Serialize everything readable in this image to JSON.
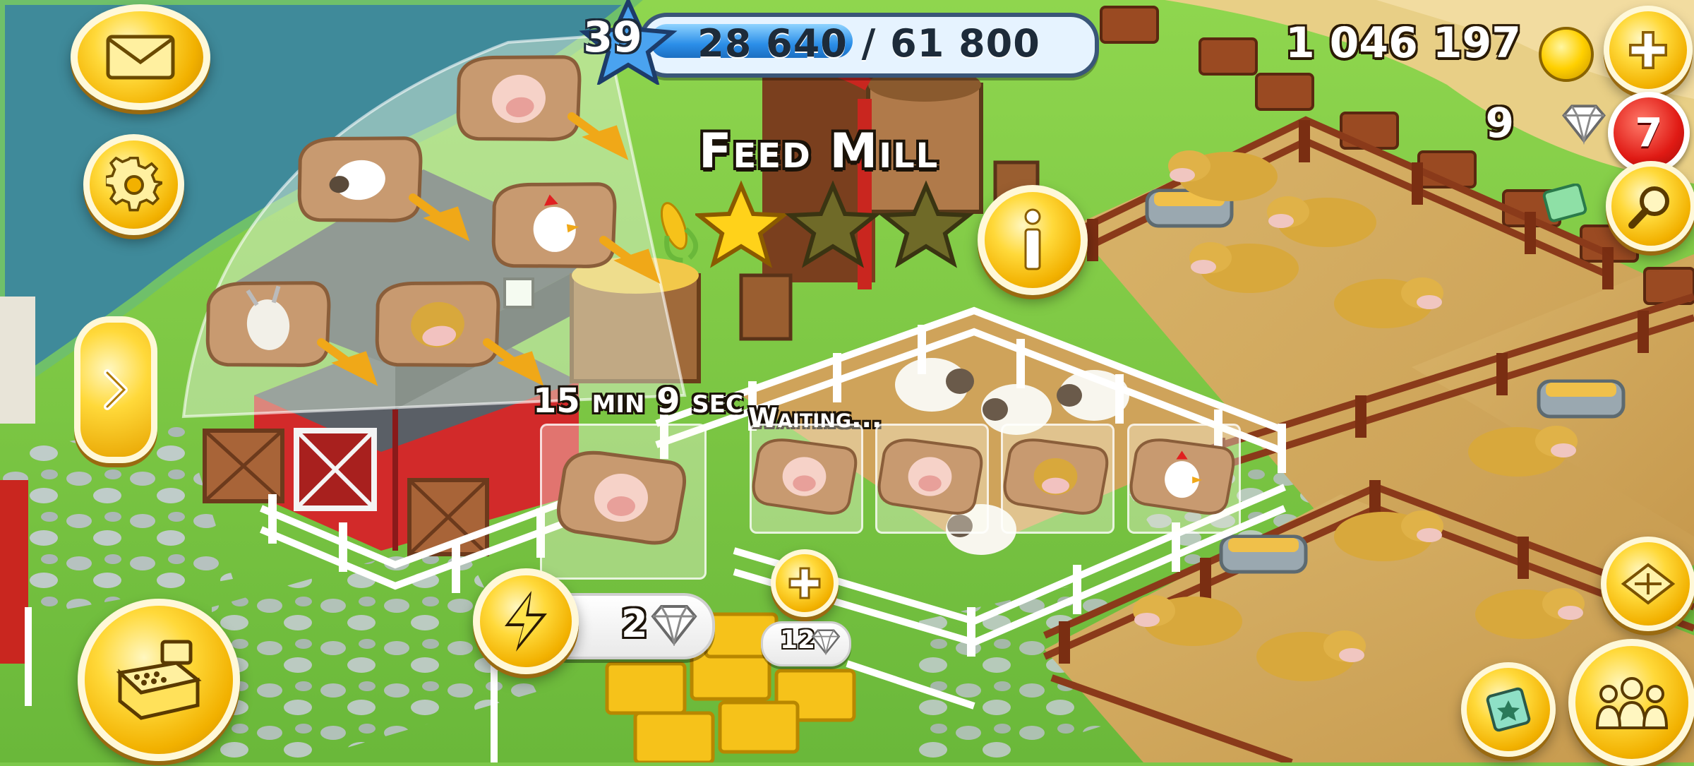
{
  "hud": {
    "level": "39",
    "xp_text": "28 640 / 61 800",
    "xp_progress": 0.463,
    "coins": "1 046 197",
    "gems": "9",
    "notification_count": "7"
  },
  "building": {
    "title": "Feed Mill",
    "stars_earned": 1,
    "stars_total": 3
  },
  "recipes": [
    {
      "input": "pig-feed",
      "animal": "pig"
    },
    {
      "input": "sheep-feed",
      "animal": "sheep"
    },
    {
      "input": "chicken-feed",
      "animal": "chicken"
    },
    {
      "input": "goat-feed",
      "animal": "goat"
    },
    {
      "input": "cow-feed",
      "animal": "cow"
    }
  ],
  "production": {
    "current_item": "pig-feed",
    "timer": "15 min 9 sec",
    "skip_cost": "2",
    "queue_label": "Waiting...",
    "queue": [
      "pig-feed",
      "pig-feed",
      "cow-feed",
      "chicken-feed"
    ],
    "add_slot_cost": "12"
  },
  "icons": {
    "mail": "envelope-icon",
    "settings": "gear-icon",
    "expand": "chevron-right-icon",
    "shop": "cash-register-icon",
    "speed": "lightning-icon",
    "add_slot": "plus-icon",
    "info": "info-icon",
    "add_coins": "plus-icon",
    "search": "magnifier-icon",
    "friends": "people-icon",
    "expansion": "land-expand-icon",
    "decor": "puzzle-card-icon"
  },
  "colors": {
    "gold": "#f2b100",
    "grass": "#7cc84a",
    "water": "#3f8a9a",
    "xp_blue": "#2b8ee8",
    "badge_red": "#e01a14"
  }
}
